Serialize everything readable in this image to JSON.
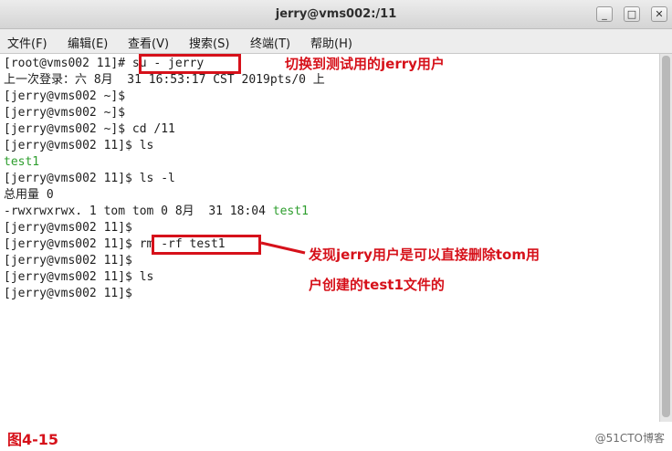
{
  "window": {
    "title": "jerry@vms002:/11",
    "controls": {
      "minimize": "_",
      "maximize": "□",
      "close": "✕"
    }
  },
  "menu": [
    {
      "label": "文件(F)"
    },
    {
      "label": "编辑(E)"
    },
    {
      "label": "查看(V)"
    },
    {
      "label": "搜索(S)"
    },
    {
      "label": "终端(T)"
    },
    {
      "label": "帮助(H)"
    }
  ],
  "terminal": {
    "lines": [
      {
        "prompt": "[root@vms002 11]# ",
        "text": "su - jerry"
      },
      {
        "prompt": "",
        "text": "上一次登录：六 8月  31 16:53:17 CST 2019pts/0 上"
      },
      {
        "prompt": "[jerry@vms002 ~]$ ",
        "text": ""
      },
      {
        "prompt": "[jerry@vms002 ~]$ ",
        "text": ""
      },
      {
        "prompt": "[jerry@vms002 ~]$ ",
        "text": "cd /11"
      },
      {
        "prompt": "[jerry@vms002 11]$ ",
        "text": "ls"
      },
      {
        "prompt": "",
        "text": "test1"
      },
      {
        "prompt": "[jerry@vms002 11]$ ",
        "text": "ls -l"
      },
      {
        "prompt": "",
        "text": "总用量 0"
      },
      {
        "prompt": "-rwxrwxrwx. 1 tom tom 0 8月  31 18:04 ",
        "text": "test1"
      },
      {
        "prompt": "[jerry@vms002 11]$ ",
        "text": ""
      },
      {
        "prompt": "[jerry@vms002 11]$ ",
        "text": "rm -rf test1"
      },
      {
        "prompt": "[jerry@vms002 11]$ ",
        "text": ""
      },
      {
        "prompt": "[jerry@vms002 11]$ ",
        "text": "ls"
      },
      {
        "prompt": "[jerry@vms002 11]$ ",
        "text": ""
      }
    ]
  },
  "annotations": {
    "note1": "切换到测试用的jerry用户",
    "note2_line1": "发现jerry用户是可以直接删除tom用",
    "note2_line2": "户创建的test1文件的"
  },
  "figure_label": "图4-15",
  "watermark": "@51CTO博客",
  "colors": {
    "annotation": "#d6111a",
    "file_green": "#2e9e2e"
  }
}
